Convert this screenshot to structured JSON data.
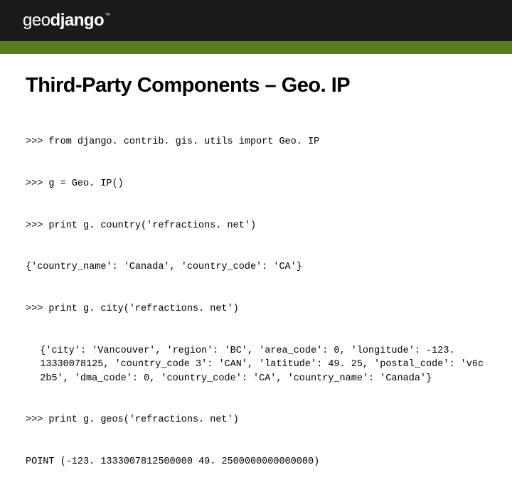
{
  "header": {
    "logo_part1": "geo",
    "logo_part2": "django",
    "logo_tm": "™"
  },
  "slide": {
    "title": "Third-Party Components – Geo. IP",
    "code_lines": [
      ">>> from django. contrib. gis. utils import Geo. IP",
      ">>> g = Geo. IP()",
      ">>> print g. country('refractions. net')",
      "{'country_name': 'Canada', 'country_code': 'CA'}",
      ">>> print g. city('refractions. net')",
      "{'city': 'Vancouver', 'region': 'BC', 'area_code': 0, 'longitude': -123. 13330078125, 'country_code 3': 'CAN', 'latitude': 49. 25, 'postal_code': 'v6c 2b5', 'dma_code': 0, 'country_code': 'CA', 'country_name': 'Canada'}",
      ">>> print g. geos('refractions. net')",
      "POINT (-123. 1333007812500000 49. 2500000000000000)"
    ]
  }
}
